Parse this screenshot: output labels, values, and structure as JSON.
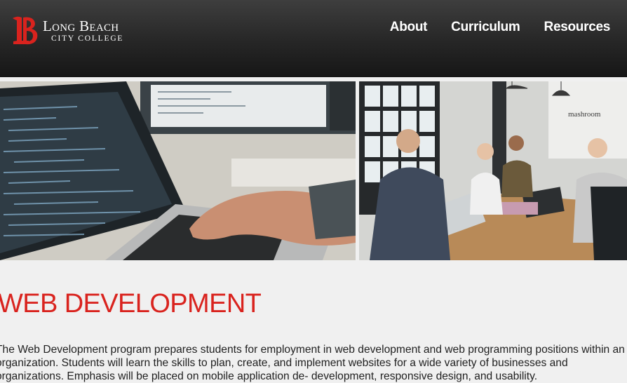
{
  "header": {
    "logo": {
      "line1": "Long Beach",
      "line2": "CITY COLLEGE",
      "mark_letters": "LB"
    },
    "nav": [
      {
        "label": "About"
      },
      {
        "label": "Curriculum"
      },
      {
        "label": "Resources"
      }
    ]
  },
  "hero": {
    "right_photo_sign": "mashroom"
  },
  "main": {
    "title": "WEB DEVELOPMENT",
    "intro": "The Web Development program prepares students for employment in web development and web programming positions within an organization. Students will learn the skills to plan, create, and implement websites for a wide variety of businesses and organizations. Emphasis will be placed on mobile application de- development, responsive design, and usability."
  },
  "colors": {
    "brand_red": "#d9231e",
    "header_dark": "#262626",
    "page_bg": "#f0f0f0"
  }
}
